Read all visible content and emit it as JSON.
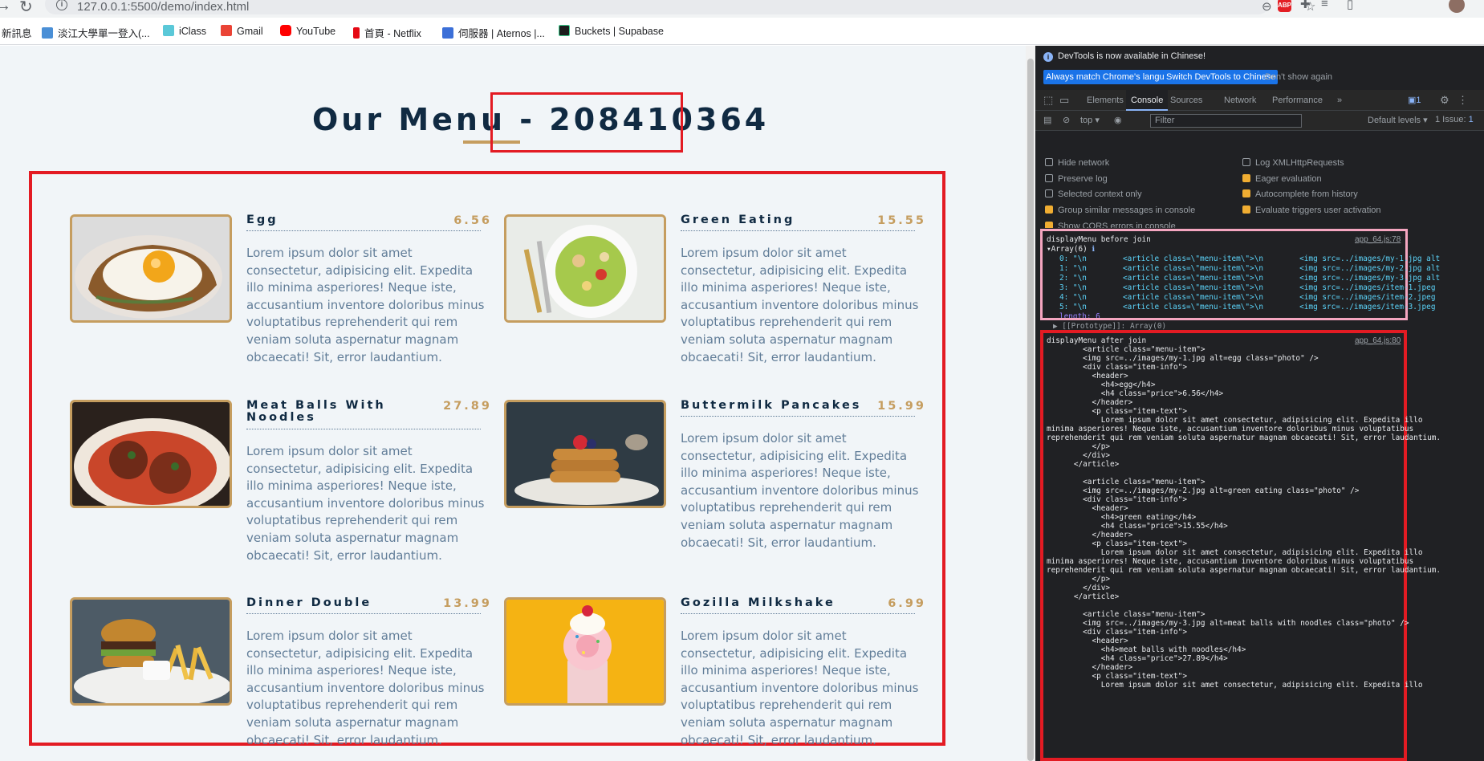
{
  "browser": {
    "url": "127.0.0.1:5500/demo/index.html",
    "bookmarks": [
      "新訊息",
      "淡江大學單一登入(...",
      "iClass",
      "Gmail",
      "YouTube",
      "首頁 - Netflix",
      "伺服器 | Aternos |...",
      "Buckets | Supabase"
    ]
  },
  "menu": {
    "title": "Our Menu - 208410364",
    "items": [
      {
        "name": "Egg",
        "price": "6.56",
        "text": "Lorem ipsum dolor sit amet consectetur, adipisicing elit. Expedita illo minima asperiores! Neque iste, accusantium inventore doloribus minus voluptatibus reprehenderit qui rem veniam soluta aspernatur magnam obcaecati! Sit, error laudantium."
      },
      {
        "name": "Green Eating",
        "price": "15.55",
        "text": "Lorem ipsum dolor sit amet consectetur, adipisicing elit. Expedita illo minima asperiores! Neque iste, accusantium inventore doloribus minus voluptatibus reprehenderit qui rem veniam soluta aspernatur magnam obcaecati! Sit, error laudantium."
      },
      {
        "name": "Meat Balls With Noodles",
        "price": "27.89",
        "text": "Lorem ipsum dolor sit amet consectetur, adipisicing elit. Expedita illo minima asperiores! Neque iste, accusantium inventore doloribus minus voluptatibus reprehenderit qui rem veniam soluta aspernatur magnam obcaecati! Sit, error laudantium."
      },
      {
        "name": "Buttermilk Pancakes",
        "price": "15.99",
        "text": "Lorem ipsum dolor sit amet consectetur, adipisicing elit. Expedita illo minima asperiores! Neque iste, accusantium inventore doloribus minus voluptatibus reprehenderit qui rem veniam soluta aspernatur magnam obcaecati! Sit, error laudantium."
      },
      {
        "name": "Dinner Double",
        "price": "13.99",
        "text": "Lorem ipsum dolor sit amet consectetur, adipisicing elit. Expedita illo minima asperiores! Neque iste, accusantium inventore doloribus minus voluptatibus reprehenderit qui rem veniam soluta aspernatur magnam obcaecati! Sit, error laudantium."
      },
      {
        "name": "Gozilla Milkshake",
        "price": "6.99",
        "text": "Lorem ipsum dolor sit amet consectetur, adipisicing elit. Expedita illo minima asperiores! Neque iste, accusantium inventore doloribus minus voluptatibus reprehenderit qui rem veniam soluta aspernatur magnam obcaecati! Sit, error laudantium."
      }
    ]
  },
  "devtools": {
    "notice": "DevTools is now available in Chinese!",
    "btn_match": "Always match Chrome's language",
    "btn_switch": "Switch DevTools to Chinese",
    "btn_dont": "Don't show again",
    "tabs": [
      "Elements",
      "Console",
      "Sources",
      "Network",
      "Performance"
    ],
    "context": "top",
    "filter_placeholder": "Filter",
    "levels": "Default levels",
    "issues": "1 Issue:",
    "issue_count": "1",
    "settings": [
      {
        "label": "Hide network",
        "on": false
      },
      {
        "label": "Log XMLHttpRequests",
        "on": false
      },
      {
        "label": "Preserve log",
        "on": false
      },
      {
        "label": "Eager evaluation",
        "on": true
      },
      {
        "label": "Selected context only",
        "on": false
      },
      {
        "label": "Autocomplete from history",
        "on": true
      },
      {
        "label": "Group similar messages in console",
        "on": true
      },
      {
        "label": "Evaluate triggers user activation",
        "on": true
      },
      {
        "label": "Show CORS errors in console",
        "on": true
      }
    ],
    "log1": {
      "label": "displayMenu before join",
      "source": "app_64.js:78",
      "array": "Array(6)",
      "rows": [
        "0: \"\\n        <article class=\\\"menu-item\\\">\\n        <img src=../images/my-1.jpg alt",
        "1: \"\\n        <article class=\\\"menu-item\\\">\\n        <img src=../images/my-2.jpg alt",
        "2: \"\\n        <article class=\\\"menu-item\\\">\\n        <img src=../images/my-3.jpg alt",
        "3: \"\\n        <article class=\\\"menu-item\\\">\\n        <img src=../images/item-1.jpeg",
        "4: \"\\n        <article class=\\\"menu-item\\\">\\n        <img src=../images/item-2.jpeg",
        "5: \"\\n        <article class=\\\"menu-item\\\">\\n        <img src=../images/item-3.jpeg"
      ],
      "length": "length: 6",
      "proto": "▶ [[Prototype]]: Array(0)"
    },
    "log2": {
      "label": "displayMenu after join",
      "source": "app_64.js:80",
      "body": "        <article class=\"menu-item\">\n        <img src=../images/my-1.jpg alt=egg class=\"photo\" />\n        <div class=\"item-info\">\n          <header>\n            <h4>egg</h4>\n            <h4 class=\"price\">6.56</h4>\n          </header>\n          <p class=\"item-text\">\n            Lorem ipsum dolor sit amet consectetur, adipisicing elit. Expedita illo\nminima asperiores! Neque iste, accusantium inventore doloribus minus voluptatibus\nreprehenderit qui rem veniam soluta aspernatur magnam obcaecati! Sit, error laudantium.\n          </p>\n        </div>\n      </article>\n\n        <article class=\"menu-item\">\n        <img src=../images/my-2.jpg alt=green eating class=\"photo\" />\n        <div class=\"item-info\">\n          <header>\n            <h4>green eating</h4>\n            <h4 class=\"price\">15.55</h4>\n          </header>\n          <p class=\"item-text\">\n            Lorem ipsum dolor sit amet consectetur, adipisicing elit. Expedita illo\nminima asperiores! Neque iste, accusantium inventore doloribus minus voluptatibus\nreprehenderit qui rem veniam soluta aspernatur magnam obcaecati! Sit, error laudantium.\n          </p>\n        </div>\n      </article>\n\n        <article class=\"menu-item\">\n        <img src=../images/my-3.jpg alt=meat balls with noodles class=\"photo\" />\n        <div class=\"item-info\">\n          <header>\n            <h4>meat balls with noodles</h4>\n            <h4 class=\"price\">27.89</h4>\n          </header>\n          <p class=\"item-text\">\n            Lorem ipsum dolor sit amet consectetur, adipisicing elit. Expedita illo"
    }
  }
}
